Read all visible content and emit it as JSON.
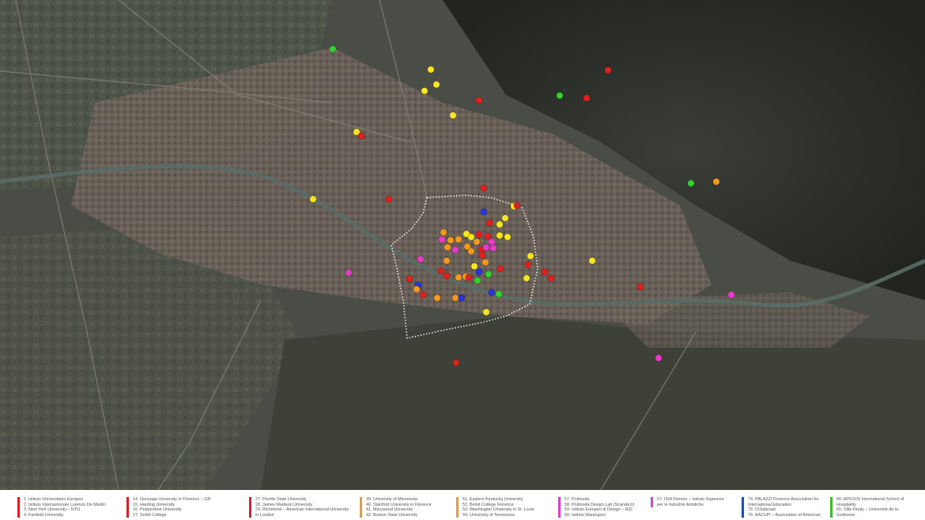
{
  "map": {
    "background": "satellite-aerial-view",
    "boundary_style": "dotted-white",
    "river_color": "#5a6b66"
  },
  "marker_colors": {
    "red": "#e0221f",
    "yellow": "#f5e61f",
    "orange": "#f59a1e",
    "magenta": "#e83cc8",
    "blue": "#2a34d8",
    "green": "#33d12e"
  },
  "legend": {
    "columns": [
      {
        "color": "#d61f26",
        "entries": [
          "1.   Istituto Universitario Europeo",
          "2.   Istituto Internazionale Lorenzo De Medici",
          "3.   New York University – NYU",
          "4.   Fairfield University"
        ]
      },
      {
        "color": "#d61f26",
        "entries": [
          "14. Gonzaga University in Florence – GIF",
          "15. Harding University",
          "16. Pepperdine University",
          "17. Smith College"
        ]
      },
      {
        "color": "#d61f26",
        "entries": [
          "27. Florida State University",
          "28. James Madison University",
          "29. Richmond – American International University",
          "      in London"
        ]
      },
      {
        "color": "#f59a1e",
        "entries": [
          "39. University of Minnesota",
          "40. Stanford University in Florence",
          "41. Marywood University",
          "42. Boston State University"
        ]
      },
      {
        "color": "#f59a1e",
        "entries": [
          "51. Eastern Kentucky University",
          "52. Beloit College Florence",
          "53. Washington University in St. Louis",
          "54. University of Tennessee"
        ]
      },
      {
        "color": "#e83cc8",
        "entries": [
          "57. Polimoda",
          "58. Polimoda Design Lab (Scandicci)",
          "59. Istituto Europeo di Design – IED",
          "60. Istituto Marangoni"
        ]
      },
      {
        "color": "#e83cc8",
        "entries": [
          "67. ISIA Firenze – Istituto Superiore",
          "per le Industrie Artistiche"
        ]
      },
      {
        "color": "#1f4ea8",
        "entries": [
          "74. PALAZZI Florence Association for",
          "International Education",
          "75. CISabroad",
          "76. AACUPI – Association of American"
        ]
      },
      {
        "color": "#3bbf2e",
        "entries": [
          "80. APICIUS International School of",
          "Hospitality",
          "81. Villa Finaly – Université de la",
          "Sorbonne"
        ]
      }
    ]
  }
}
